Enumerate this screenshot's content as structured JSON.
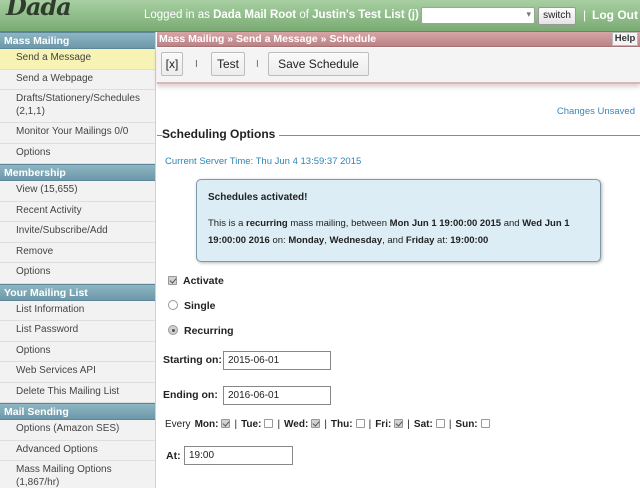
{
  "topbar": {
    "logo_text": "Dada",
    "login_prefix": "Logged in as ",
    "login_user": "Dada Mail Root",
    "login_of": " of ",
    "login_list": "Justin's Test List (j)",
    "list_select_value": "",
    "switch_label": "switch",
    "separator": "|",
    "logout_label": "Log Out"
  },
  "sidebar": {
    "sections": [
      {
        "title": "Mass Mailing",
        "items": [
          "Send a Message",
          "Send a Webpage",
          "Drafts/Stationery/Schedules (2,1,1)",
          "Monitor Your Mailings 0/0",
          "Options"
        ]
      },
      {
        "title": "Membership",
        "items": [
          "View (15,655)",
          "Recent Activity",
          "Invite/Subscribe/Add",
          "Remove",
          "Options"
        ]
      },
      {
        "title": "Your Mailing List",
        "items": [
          "List Information",
          "List Password",
          "Options",
          "Web Services API",
          "Delete This Mailing List"
        ]
      },
      {
        "title": "Mail Sending",
        "items": [
          "Options (Amazon SES)",
          "Advanced Options",
          "Mass Mailing Options (1,867/hr)"
        ]
      }
    ]
  },
  "main": {
    "breadcrumb": "Mass Mailing » Send a Message » Schedule",
    "help_label": "Help",
    "toolbar": {
      "close_label": "[x]",
      "sep": "I",
      "test_label": "Test",
      "save_label": "Save Schedule"
    },
    "changes_status": "Changes Unsaved",
    "section_title": "Scheduling Options",
    "server_time": "Current Server Time: Thu Jun 4 13:59:37 2015",
    "notice": {
      "title": "Schedules activated!",
      "t1": "This is a ",
      "b1": "recurring",
      "t2": " mass mailing, between ",
      "b2": "Mon Jun 1 19:00:00 2015",
      "t3": " and ",
      "b3": "Wed Jun 1 19:00:00 2016",
      "t4": " on: ",
      "b4": "Monday",
      "t5": ", ",
      "b5": "Wednesday",
      "t6": ", and ",
      "b6": "Friday",
      "t7": " at: ",
      "b7": "19:00:00"
    },
    "activate_label": "Activate",
    "activate_checked": true,
    "single_label": "Single",
    "recurring_label": "Recurring",
    "selected_mode": "Recurring",
    "starting_label": "Starting on:",
    "starting_value": "2015-06-01",
    "ending_label": "Ending on:",
    "ending_value": "2016-06-01",
    "every_label": "Every",
    "days": [
      {
        "label": "Mon:",
        "checked": true
      },
      {
        "label": "Tue:",
        "checked": false
      },
      {
        "label": "Wed:",
        "checked": true
      },
      {
        "label": "Thu:",
        "checked": false
      },
      {
        "label": "Fri:",
        "checked": true
      },
      {
        "label": "Sat:",
        "checked": false
      },
      {
        "label": "Sun:",
        "checked": false
      }
    ],
    "day_sep": "|",
    "at_label": "At:",
    "at_value": "19:00"
  }
}
